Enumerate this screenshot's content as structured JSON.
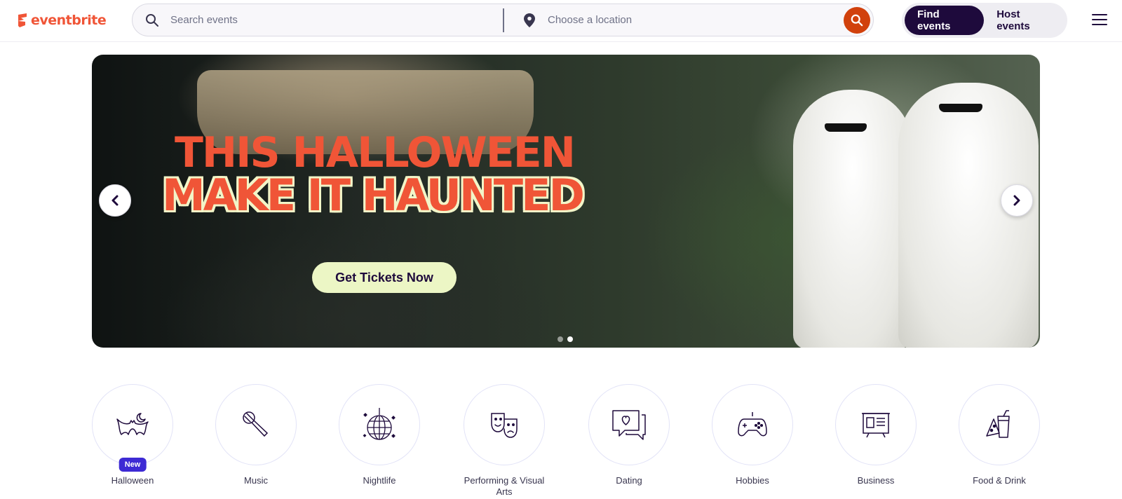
{
  "header": {
    "logo_text": "eventbrite",
    "search": {
      "placeholder": "Search events"
    },
    "location": {
      "placeholder": "Choose a location"
    },
    "nav": {
      "find_events": "Find events",
      "host_events": "Host events"
    }
  },
  "hero": {
    "title_line1": "THIS HALLOWEEN",
    "title_line2": "MAKE IT HAUNTED",
    "cta": "Get Tickets Now",
    "slides": 2,
    "active_slide": 2
  },
  "categories": [
    {
      "label": "Halloween",
      "icon": "bat-moon-icon",
      "badge": "New"
    },
    {
      "label": "Music",
      "icon": "microphone-icon"
    },
    {
      "label": "Nightlife",
      "icon": "disco-ball-icon"
    },
    {
      "label": "Performing & Visual Arts",
      "icon": "theater-masks-icon"
    },
    {
      "label": "Dating",
      "icon": "chat-heart-icon"
    },
    {
      "label": "Hobbies",
      "icon": "gamepad-icon"
    },
    {
      "label": "Business",
      "icon": "presentation-board-icon"
    },
    {
      "label": "Food & Drink",
      "icon": "food-drink-icon"
    }
  ],
  "colors": {
    "brand": "#f05537",
    "dark": "#1e0a3c",
    "search_button": "#d1410c",
    "badge": "#3d2ad4",
    "cta_bg": "#ecf6c5"
  }
}
